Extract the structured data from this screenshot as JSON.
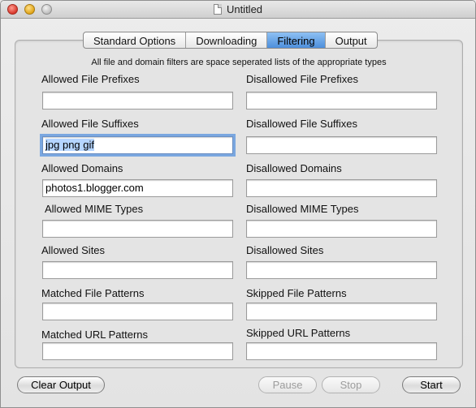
{
  "window": {
    "title": "Untitled"
  },
  "tabs": [
    {
      "label": "Standard Options",
      "active": false
    },
    {
      "label": "Downloading",
      "active": false
    },
    {
      "label": "Filtering",
      "active": true
    },
    {
      "label": "Output",
      "active": false
    }
  ],
  "note": "All file and domain filters are space seperated lists of the appropriate types",
  "filters": {
    "allowed_prefixes": {
      "label": "Allowed File Prefixes",
      "value": ""
    },
    "disallowed_prefixes": {
      "label": "Disallowed File Prefixes",
      "value": ""
    },
    "allowed_suffixes": {
      "label": "Allowed File Suffixes",
      "value": "jpg png gif"
    },
    "disallowed_suffixes": {
      "label": "Disallowed File Suffixes",
      "value": ""
    },
    "allowed_domains": {
      "label": "Allowed Domains",
      "value": "photos1.blogger.com"
    },
    "disallowed_domains": {
      "label": "Disallowed Domains",
      "value": ""
    },
    "allowed_mime": {
      "label": "Allowed MIME Types",
      "value": ""
    },
    "disallowed_mime": {
      "label": "Disallowed MIME Types",
      "value": ""
    },
    "allowed_sites": {
      "label": "Allowed Sites",
      "value": ""
    },
    "disallowed_sites": {
      "label": "Disallowed Sites",
      "value": ""
    },
    "matched_file": {
      "label": "Matched File Patterns",
      "value": ""
    },
    "skipped_file": {
      "label": "Skipped File Patterns",
      "value": ""
    },
    "matched_url": {
      "label": "Matched URL Patterns",
      "value": ""
    },
    "skipped_url": {
      "label": "Skipped URL Patterns",
      "value": ""
    }
  },
  "buttons": {
    "clear_output": "Clear Output",
    "pause": "Pause",
    "stop": "Stop",
    "start": "Start"
  }
}
